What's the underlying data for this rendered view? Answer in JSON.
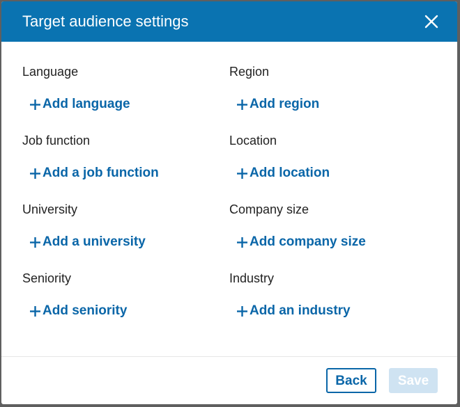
{
  "dialog": {
    "title": "Target audience settings",
    "close_icon": "close-icon"
  },
  "fields": {
    "left": [
      {
        "label": "Language",
        "action": "Add language"
      },
      {
        "label": "Job function",
        "action": "Add a job function"
      },
      {
        "label": "University",
        "action": "Add a university"
      },
      {
        "label": "Seniority",
        "action": "Add seniority"
      }
    ],
    "right": [
      {
        "label": "Region",
        "action": "Add region"
      },
      {
        "label": "Location",
        "action": "Add location"
      },
      {
        "label": "Company size",
        "action": "Add company size"
      },
      {
        "label": "Industry",
        "action": "Add an industry"
      }
    ]
  },
  "footer": {
    "back_label": "Back",
    "save_label": "Save",
    "save_disabled": true
  },
  "colors": {
    "header_bg": "#0a73b1",
    "link": "#0a66a8",
    "save_disabled_bg": "#cfe3f2"
  }
}
